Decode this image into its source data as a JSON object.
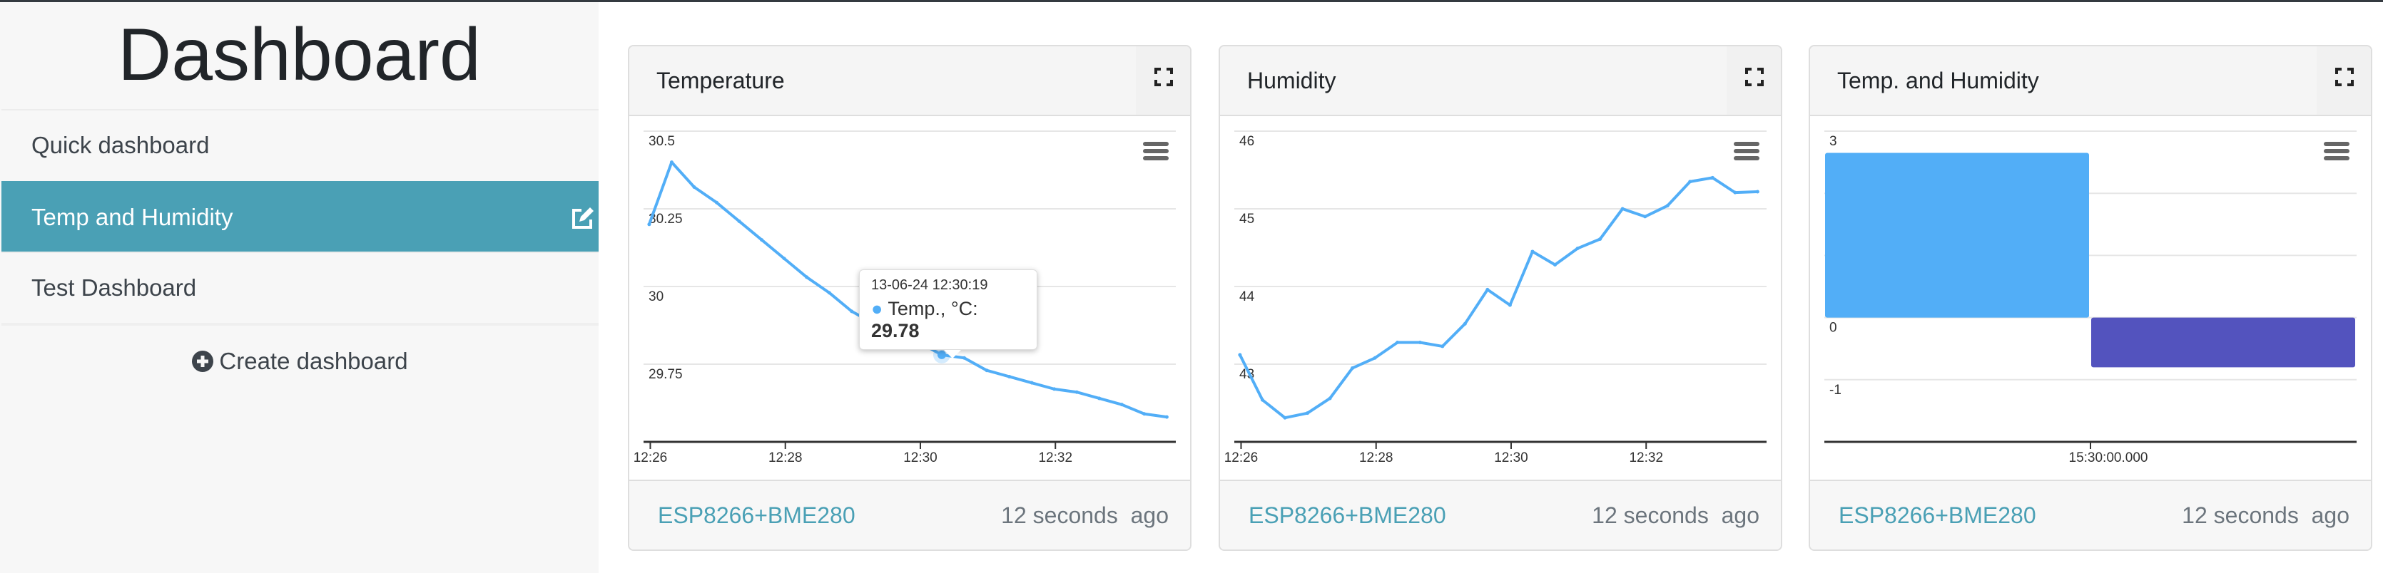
{
  "sidebar": {
    "title": "Dashboard",
    "items": [
      {
        "label": "Quick dashboard",
        "active": false
      },
      {
        "label": "Temp and Humidity",
        "active": true
      },
      {
        "label": "Test Dashboard",
        "active": false
      }
    ],
    "create_label": "Create dashboard"
  },
  "colors": {
    "accent": "#4aa0b5",
    "series_blue": "#52aef7",
    "series_purple": "#5353be"
  },
  "cards": [
    {
      "title": "Temperature",
      "source": "ESP8266+BME280",
      "updated": "12 seconds  ago",
      "tooltip": {
        "timestamp": "13-06-24 12:30:19",
        "series": "Temp., °C: ",
        "value": "29.78"
      }
    },
    {
      "title": "Humidity",
      "source": "ESP8266+BME280",
      "updated": "12 seconds  ago"
    },
    {
      "title": "Temp. and Humidity",
      "source": "ESP8266+BME280",
      "updated": "12 seconds  ago"
    }
  ],
  "chart_data": [
    {
      "type": "line",
      "series": [
        {
          "name": "Temp., °C",
          "color": "#52aef7",
          "x": [
            "12:25:59",
            "12:26:19",
            "12:26:39",
            "12:26:59",
            "12:27:19",
            "12:27:39",
            "12:27:59",
            "12:28:19",
            "12:28:39",
            "12:28:59",
            "12:29:19",
            "12:29:39",
            "12:29:59",
            "12:30:19",
            "12:30:39",
            "12:30:59",
            "12:31:19",
            "12:31:39",
            "12:31:59",
            "12:32:19",
            "12:32:39",
            "12:32:59",
            "12:33:19",
            "12:33:39"
          ],
          "values": [
            30.2,
            30.4,
            30.32,
            30.27,
            30.21,
            30.15,
            30.09,
            30.03,
            29.98,
            29.92,
            29.88,
            29.85,
            29.82,
            29.78,
            29.77,
            29.73,
            29.71,
            29.69,
            29.67,
            29.66,
            29.64,
            29.62,
            29.59,
            29.58
          ]
        }
      ],
      "xlim": [
        "12:25:54",
        "12:33:47"
      ],
      "ylim": [
        29.5,
        30.5
      ],
      "yticks": [
        "30.5",
        "30.25",
        "30",
        "29.75"
      ],
      "ytick_values": [
        30.5,
        30.25,
        30,
        29.75
      ],
      "xticks": [
        "12:26",
        "12:28",
        "12:30",
        "12:32"
      ],
      "grid": true,
      "highlight_index": 13
    },
    {
      "type": "line",
      "series": [
        {
          "color": "#52aef7",
          "x": [
            "12:25:59",
            "12:26:19",
            "12:26:39",
            "12:26:59",
            "12:27:19",
            "12:27:39",
            "12:27:59",
            "12:28:19",
            "12:28:39",
            "12:28:59",
            "12:29:19",
            "12:29:39",
            "12:29:59",
            "12:30:19",
            "12:30:39",
            "12:30:59",
            "12:31:19",
            "12:31:39",
            "12:31:59",
            "12:32:19",
            "12:32:39",
            "12:32:59",
            "12:33:19",
            "12:33:39"
          ],
          "values": [
            43.12,
            42.54,
            42.31,
            42.37,
            42.56,
            42.95,
            43.08,
            43.28,
            43.28,
            43.23,
            43.52,
            43.96,
            43.76,
            44.45,
            44.28,
            44.49,
            44.61,
            45.0,
            44.9,
            45.04,
            45.35,
            45.4,
            45.21,
            45.22
          ]
        }
      ],
      "xlim": [
        "12:25:54",
        "12:33:47"
      ],
      "ylim": [
        42,
        46
      ],
      "yticks": [
        "46",
        "45",
        "44",
        "43"
      ],
      "ytick_values": [
        46,
        45,
        44,
        43
      ],
      "xticks": [
        "12:26",
        "12:28",
        "12:30",
        "12:32"
      ],
      "grid": true
    },
    {
      "type": "bar",
      "categories": [
        "15:30:00.000"
      ],
      "series": [
        {
          "color": "#52aef7",
          "values": [
            2.65
          ]
        },
        {
          "color": "#5353be",
          "values": [
            -0.8
          ]
        }
      ],
      "ylim": [
        -2,
        3
      ],
      "yticks": [
        "3",
        "2",
        "1",
        "0",
        "-1"
      ],
      "ytick_values": [
        3,
        2,
        1,
        0,
        -1
      ],
      "xticks": [
        "15:30:00.000"
      ],
      "grid": true
    }
  ]
}
